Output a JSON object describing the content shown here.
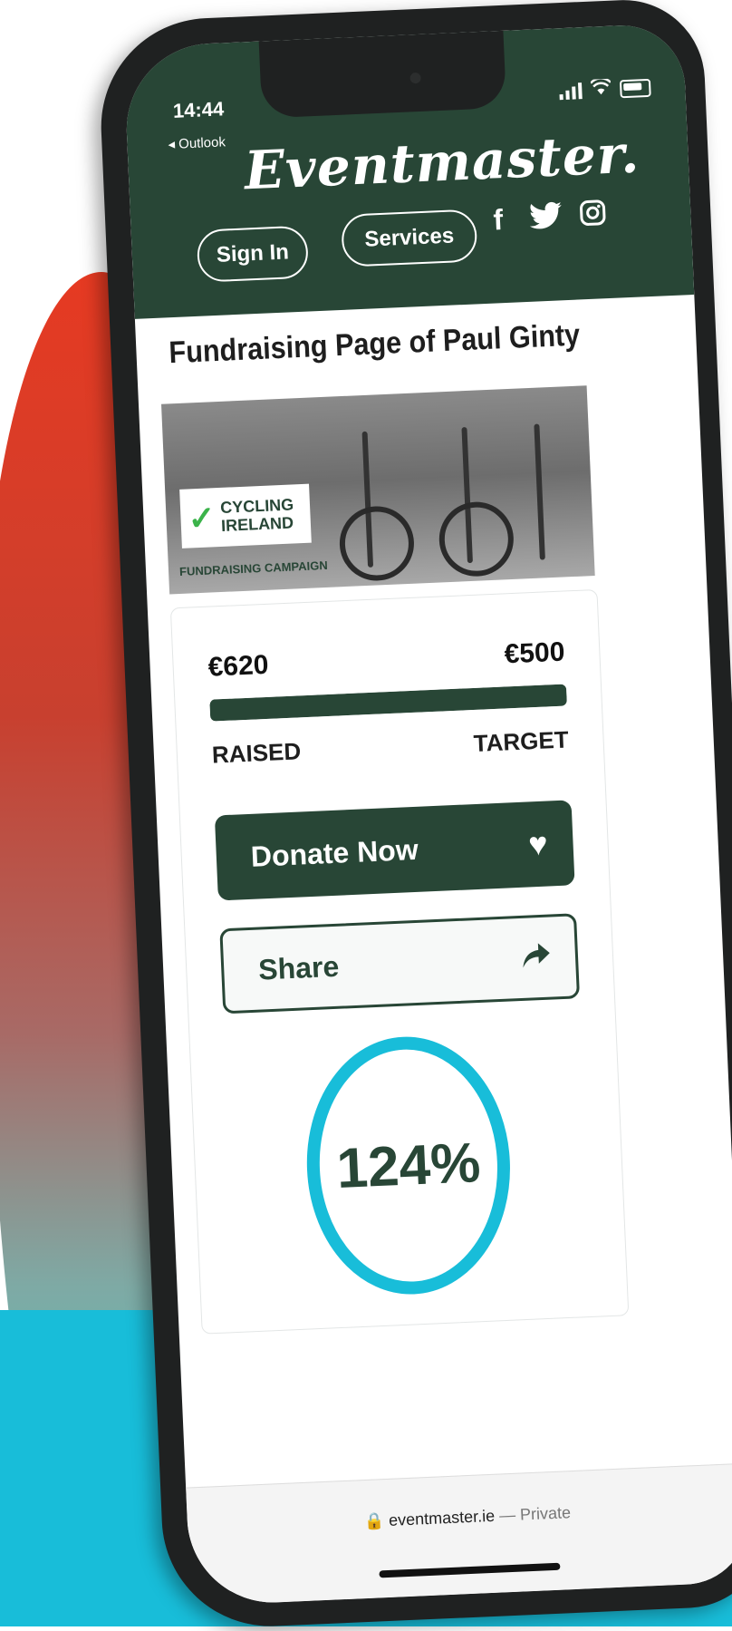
{
  "status_bar": {
    "time": "14:44",
    "back_label": "◂ Outlook",
    "icons": [
      "signal-icon",
      "wifi-icon",
      "battery-icon"
    ]
  },
  "header": {
    "logo": "Eventmaster.",
    "nav": {
      "sign_in": "Sign In",
      "services": "Services"
    },
    "social": [
      "facebook-icon",
      "twitter-icon",
      "instagram-icon"
    ],
    "background_color": "#284636"
  },
  "page": {
    "title": "Fundraising Page of Paul Ginty"
  },
  "banner": {
    "logo_text_line1": "CYCLING",
    "logo_text_line2": "IRELAND",
    "caption": "FUNDRAISING CAMPAIGN"
  },
  "progress": {
    "raised_amount": "€620",
    "target_amount": "€500",
    "raised_label": "RAISED",
    "target_label": "TARGET",
    "fill_fraction": 1.0,
    "percent_text": "124%"
  },
  "actions": {
    "donate_label": "Donate Now",
    "share_label": "Share"
  },
  "browser": {
    "url": "eventmaster.ie",
    "privacy": "— Private"
  },
  "colors": {
    "brand_green": "#284636",
    "ring_cyan": "#18bdd9",
    "background_cyan": "#18bdd9"
  }
}
